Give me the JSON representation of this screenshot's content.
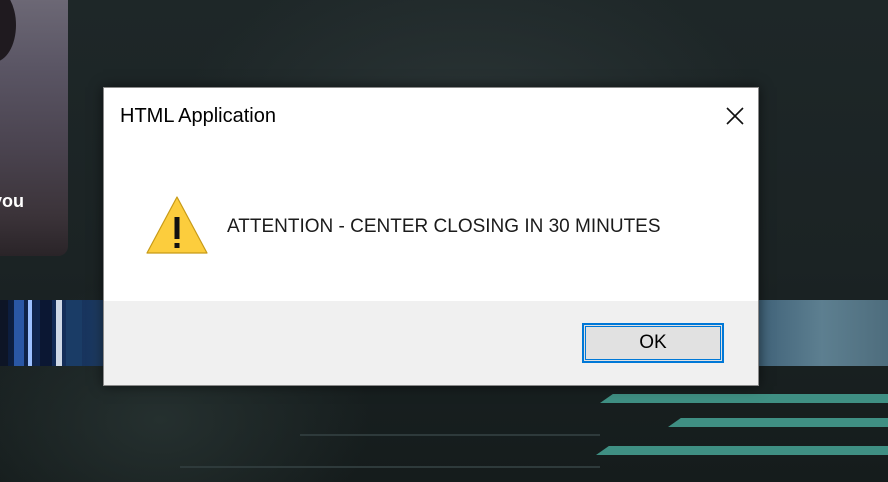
{
  "background": {
    "card_caption": "you"
  },
  "dialog": {
    "title": "HTML Application",
    "message": "ATTENTION - CENTER CLOSING IN 30 MINUTES",
    "icon": "warning-icon",
    "ok_label": "OK",
    "close_icon": "close-icon"
  },
  "colors": {
    "focus_border": "#0078d7",
    "footer": "#f0f0f0",
    "warning_fill": "#fccd3d"
  }
}
